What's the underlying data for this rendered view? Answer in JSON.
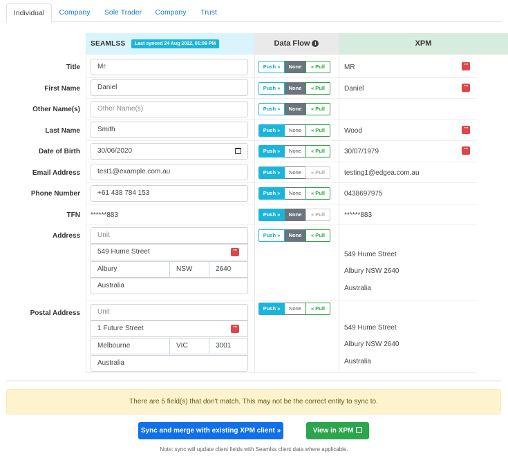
{
  "tabs": [
    "Individual",
    "Company",
    "Sole Trader",
    "Company",
    "Trust"
  ],
  "header": {
    "brand": "SEAMLSS",
    "sync_badge": "Last synced 24 Aug 2022, 01:09 PM",
    "flow_label": "Data Flow",
    "xpm_label": "XPM"
  },
  "toggle_labels": {
    "push": "Push »",
    "none": "None",
    "pull": "« Pull"
  },
  "rows": [
    {
      "label": "Title",
      "seamlss": "Mr",
      "xpm": "MR",
      "state": "none",
      "mismatch": true
    },
    {
      "label": "First Name",
      "seamlss": "Daniel",
      "xpm": "Daniel",
      "state": "none",
      "mismatch": true
    },
    {
      "label": "Other Name(s)",
      "seamlss_placeholder": "Other Name(s)",
      "xpm": "",
      "state": "none",
      "mismatch": false
    },
    {
      "label": "Last Name",
      "seamlss": "Smith",
      "xpm": "Wood",
      "state": "push",
      "mismatch": true
    },
    {
      "label": "Date of Birth",
      "seamlss": "30/06/2020",
      "xpm": "30/07/1979",
      "state": "push",
      "mismatch": true
    },
    {
      "label": "Email Address",
      "seamlss": "test1@example.com.au",
      "xpm": "testing1@edgea.com.au",
      "state": "push",
      "pull_disabled": true
    },
    {
      "label": "Phone Number",
      "seamlss": "+61 438 784 153",
      "xpm": "0438697975",
      "state": "push"
    },
    {
      "label": "TFN",
      "seamlss": "******883",
      "xpm": "******883",
      "state": "none",
      "pull_disabled": true
    }
  ],
  "address": {
    "label": "Address",
    "unit_placeholder": "Unit",
    "street": "549 Hume Street",
    "suburb": "Albury",
    "state": "NSW",
    "postcode": "2640",
    "country": "Australia",
    "xpm_lines": [
      "549 Hume Street",
      "Albury NSW 2640",
      "Australia"
    ],
    "toggle_state": "none"
  },
  "postal_address": {
    "label": "Postal Address",
    "unit_placeholder": "Unit",
    "street": "1 Future Street",
    "suburb": "Melbourne",
    "state": "VIC",
    "postcode": "3001",
    "country": "Australia",
    "xpm_lines": [
      "549 Hume Street",
      "Albury NSW 2640",
      "Australia"
    ],
    "toggle_state": "push"
  },
  "alert": "There are 5 field(s) that don't match. This may not be the correct entity to sync to.",
  "buttons": {
    "sync": "Sync and merge with existing XPM client »",
    "view": "View in XPM"
  },
  "note": "Note: sync will update client fields with Seamlss client data where applicable.",
  "colors": {
    "push": "#1cb5d9",
    "none": "#6c757d",
    "pull": "#28a745",
    "mismatch": "#dc4747",
    "primary": "#1170e8"
  }
}
